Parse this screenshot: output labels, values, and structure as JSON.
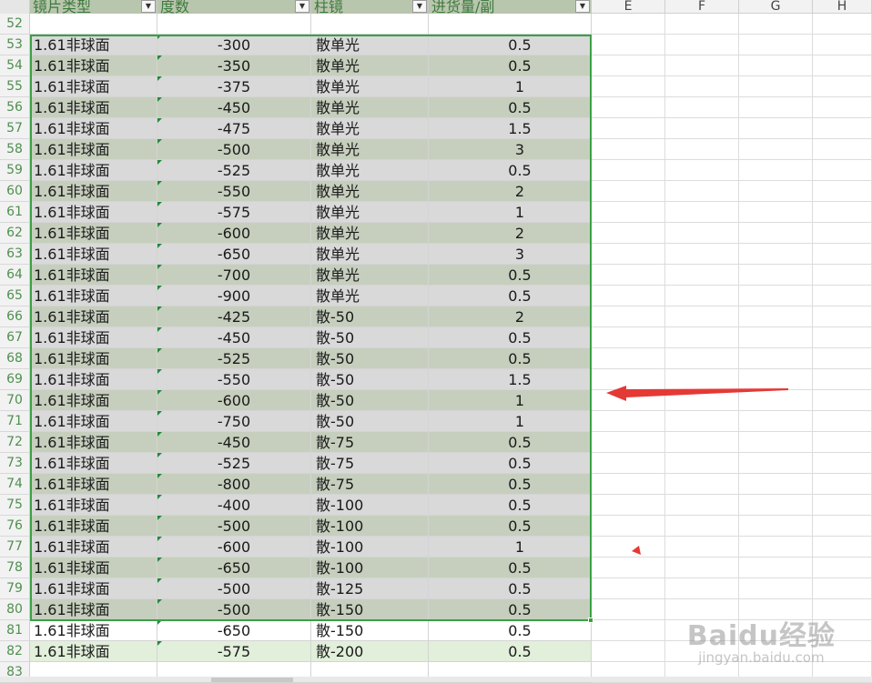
{
  "header": {
    "columns": [
      "镜片类型",
      "度数",
      "柱镜",
      "进货量/副"
    ],
    "extra_columns": [
      "E",
      "F",
      "G",
      "H"
    ],
    "filter_glyph": "▼"
  },
  "rows": [
    {
      "num": "52",
      "cells": [
        "",
        "",
        "",
        ""
      ],
      "fill": "blank"
    },
    {
      "num": "53",
      "cells": [
        "1.61非球面",
        "-300",
        "散单光",
        "0.5"
      ],
      "fill": "gray"
    },
    {
      "num": "54",
      "cells": [
        "1.61非球面",
        "-350",
        "散单光",
        "0.5"
      ],
      "fill": "green"
    },
    {
      "num": "55",
      "cells": [
        "1.61非球面",
        "-375",
        "散单光",
        "1"
      ],
      "fill": "gray"
    },
    {
      "num": "56",
      "cells": [
        "1.61非球面",
        "-450",
        "散单光",
        "0.5"
      ],
      "fill": "green"
    },
    {
      "num": "57",
      "cells": [
        "1.61非球面",
        "-475",
        "散单光",
        "1.5"
      ],
      "fill": "gray"
    },
    {
      "num": "58",
      "cells": [
        "1.61非球面",
        "-500",
        "散单光",
        "3"
      ],
      "fill": "green"
    },
    {
      "num": "59",
      "cells": [
        "1.61非球面",
        "-525",
        "散单光",
        "0.5"
      ],
      "fill": "gray"
    },
    {
      "num": "60",
      "cells": [
        "1.61非球面",
        "-550",
        "散单光",
        "2"
      ],
      "fill": "green"
    },
    {
      "num": "61",
      "cells": [
        "1.61非球面",
        "-575",
        "散单光",
        "1"
      ],
      "fill": "gray"
    },
    {
      "num": "62",
      "cells": [
        "1.61非球面",
        "-600",
        "散单光",
        "2"
      ],
      "fill": "green"
    },
    {
      "num": "63",
      "cells": [
        "1.61非球面",
        "-650",
        "散单光",
        "3"
      ],
      "fill": "gray"
    },
    {
      "num": "64",
      "cells": [
        "1.61非球面",
        "-700",
        "散单光",
        "0.5"
      ],
      "fill": "green"
    },
    {
      "num": "65",
      "cells": [
        "1.61非球面",
        "-900",
        "散单光",
        "0.5"
      ],
      "fill": "gray"
    },
    {
      "num": "66",
      "cells": [
        "1.61非球面",
        "-425",
        "散-50",
        "2"
      ],
      "fill": "green"
    },
    {
      "num": "67",
      "cells": [
        "1.61非球面",
        "-450",
        "散-50",
        "0.5"
      ],
      "fill": "gray"
    },
    {
      "num": "68",
      "cells": [
        "1.61非球面",
        "-525",
        "散-50",
        "0.5"
      ],
      "fill": "green"
    },
    {
      "num": "69",
      "cells": [
        "1.61非球面",
        "-550",
        "散-50",
        "1.5"
      ],
      "fill": "gray"
    },
    {
      "num": "70",
      "cells": [
        "1.61非球面",
        "-600",
        "散-50",
        "1"
      ],
      "fill": "green"
    },
    {
      "num": "71",
      "cells": [
        "1.61非球面",
        "-750",
        "散-50",
        "1"
      ],
      "fill": "gray"
    },
    {
      "num": "72",
      "cells": [
        "1.61非球面",
        "-450",
        "散-75",
        "0.5"
      ],
      "fill": "green"
    },
    {
      "num": "73",
      "cells": [
        "1.61非球面",
        "-525",
        "散-75",
        "0.5"
      ],
      "fill": "gray"
    },
    {
      "num": "74",
      "cells": [
        "1.61非球面",
        "-800",
        "散-75",
        "0.5"
      ],
      "fill": "green"
    },
    {
      "num": "75",
      "cells": [
        "1.61非球面",
        "-400",
        "散-100",
        "0.5"
      ],
      "fill": "gray"
    },
    {
      "num": "76",
      "cells": [
        "1.61非球面",
        "-500",
        "散-100",
        "0.5"
      ],
      "fill": "green"
    },
    {
      "num": "77",
      "cells": [
        "1.61非球面",
        "-600",
        "散-100",
        "1"
      ],
      "fill": "gray"
    },
    {
      "num": "78",
      "cells": [
        "1.61非球面",
        "-650",
        "散-100",
        "0.5"
      ],
      "fill": "green"
    },
    {
      "num": "79",
      "cells": [
        "1.61非球面",
        "-500",
        "散-125",
        "0.5"
      ],
      "fill": "gray"
    },
    {
      "num": "80",
      "cells": [
        "1.61非球面",
        "-500",
        "散-150",
        "0.5"
      ],
      "fill": "green"
    },
    {
      "num": "81",
      "cells": [
        "1.61非球面",
        "-650",
        "散-150",
        "0.5"
      ],
      "fill": "white"
    },
    {
      "num": "82",
      "cells": [
        "1.61非球面",
        "-575",
        "散-200",
        "0.5"
      ],
      "fill": "light"
    },
    {
      "num": "83",
      "cells": [
        "",
        "",
        "",
        ""
      ],
      "fill": "blank"
    }
  ],
  "colors": {
    "selection_border": "#3aa145",
    "arrow": "#e53935",
    "row_number": "#4f8f4f"
  },
  "watermark": {
    "main": "Baidu经验",
    "sub": "jingyan.baidu.com"
  }
}
